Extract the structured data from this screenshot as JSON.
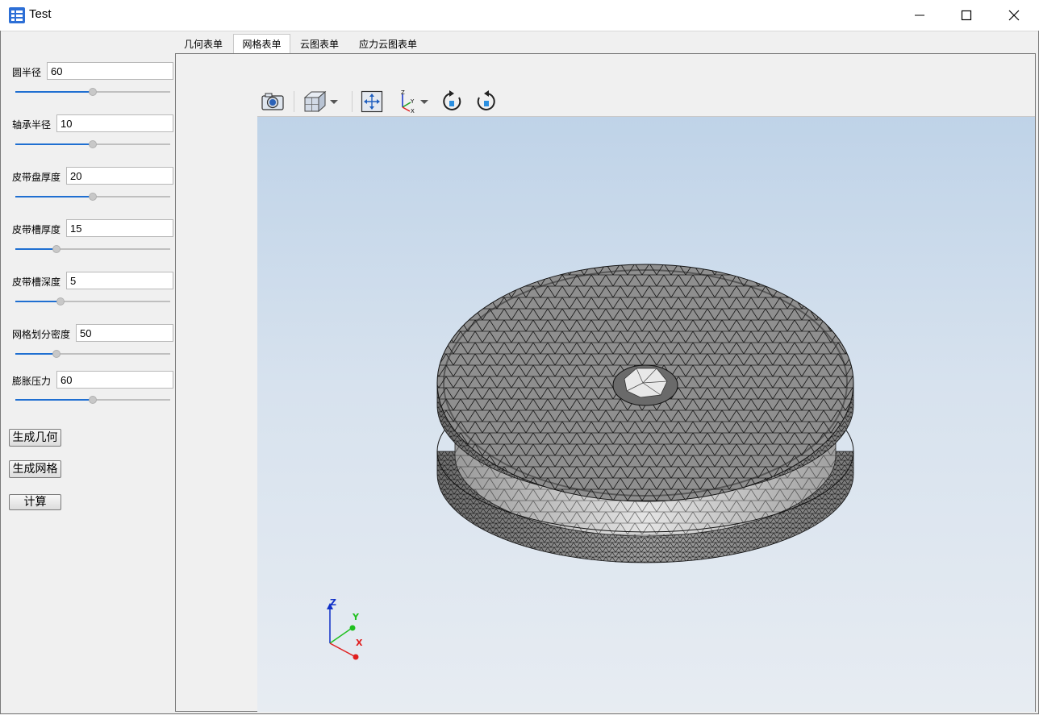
{
  "window": {
    "title": "Test"
  },
  "params": [
    {
      "label": "圆半径",
      "value": "60",
      "slider": 0.5
    },
    {
      "label": "轴承半径",
      "value": "10",
      "slider": 0.5
    },
    {
      "label": "皮带盘厚度",
      "value": "20",
      "slider": 0.5
    },
    {
      "label": "皮带槽厚度",
      "value": "15",
      "slider": 0.25
    },
    {
      "label": "皮带槽深度",
      "value": "5",
      "slider": 0.28
    },
    {
      "label": "网格划分密度",
      "value": "50",
      "slider": 0.25
    },
    {
      "label": "膨胀压力",
      "value": "60",
      "slider": 0.5
    }
  ],
  "buttons": {
    "gen_geometry": "生成几何",
    "gen_mesh": "生成网格",
    "compute": "计算"
  },
  "tabs": [
    {
      "label": "几何表单",
      "active": false
    },
    {
      "label": "网格表单",
      "active": true
    },
    {
      "label": "云图表单",
      "active": false
    },
    {
      "label": "应力云图表单",
      "active": false
    }
  ],
  "toolbar": [
    "camera-icon",
    "cube-view-icon",
    "fit-all-icon",
    "axes-view-icon",
    "rotate-cw-icon",
    "rotate-ccw-icon"
  ],
  "axes": {
    "x": "X",
    "y": "Y",
    "z": "Z"
  },
  "colors": {
    "axis_x": "#e02020",
    "axis_y": "#20c020",
    "axis_z": "#1030c8",
    "mesh_face": "#8f8f8f",
    "mesh_line": "#1a1a1a"
  }
}
